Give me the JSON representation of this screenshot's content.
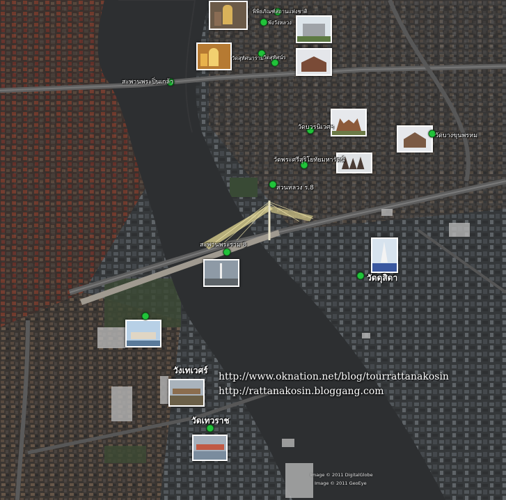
{
  "map": {
    "type": "aerial-satellite",
    "river": "chao-phraya",
    "place_labels": [
      {
        "id": "museum",
        "text": "พิพิธภัณฑ์สถานแห่งชาติ"
      },
      {
        "id": "wanglang",
        "text": "พังวังหลวง"
      },
      {
        "id": "arun_temple",
        "text": "วัดสุทัศนาราม"
      },
      {
        "id": "suthat",
        "text": "วัดสุทัศน์ร"
      },
      {
        "id": "pinklao",
        "text": "สะพานพระปิ่นเกล้า"
      },
      {
        "id": "watbowon",
        "text": "วัดบวรนิเวศฯ"
      },
      {
        "id": "watyai",
        "text": "วัดบางขุนพรหม"
      },
      {
        "id": "siri",
        "text": "วัดพระศรีสุริโยทัยมหารัตน์"
      },
      {
        "id": "suanluang",
        "text": "สวนหลวง ร.8"
      },
      {
        "id": "rama8",
        "text": "สะพานพระราม 8"
      },
      {
        "id": "dusit",
        "text": "วัดดุสิดา"
      },
      {
        "id": "thewet",
        "text": "วังเทเวศร์"
      },
      {
        "id": "thewaraj",
        "text": "วัดเทวราช"
      }
    ],
    "urls": [
      "http://www.oknation.net/blog/tourrattanakosin",
      "http://rattanakosin.bloggang.com"
    ],
    "credits": [
      "Image © 2011 DigitalGlobe",
      "Image © 2011 GeoEye"
    ],
    "colors": {
      "placemark": "#21c33a",
      "river": "#2d2f31",
      "label": "#ffffff"
    },
    "icons": {
      "placemark": "green-dot-icon",
      "photo": "photo-thumbnail-icon"
    }
  }
}
